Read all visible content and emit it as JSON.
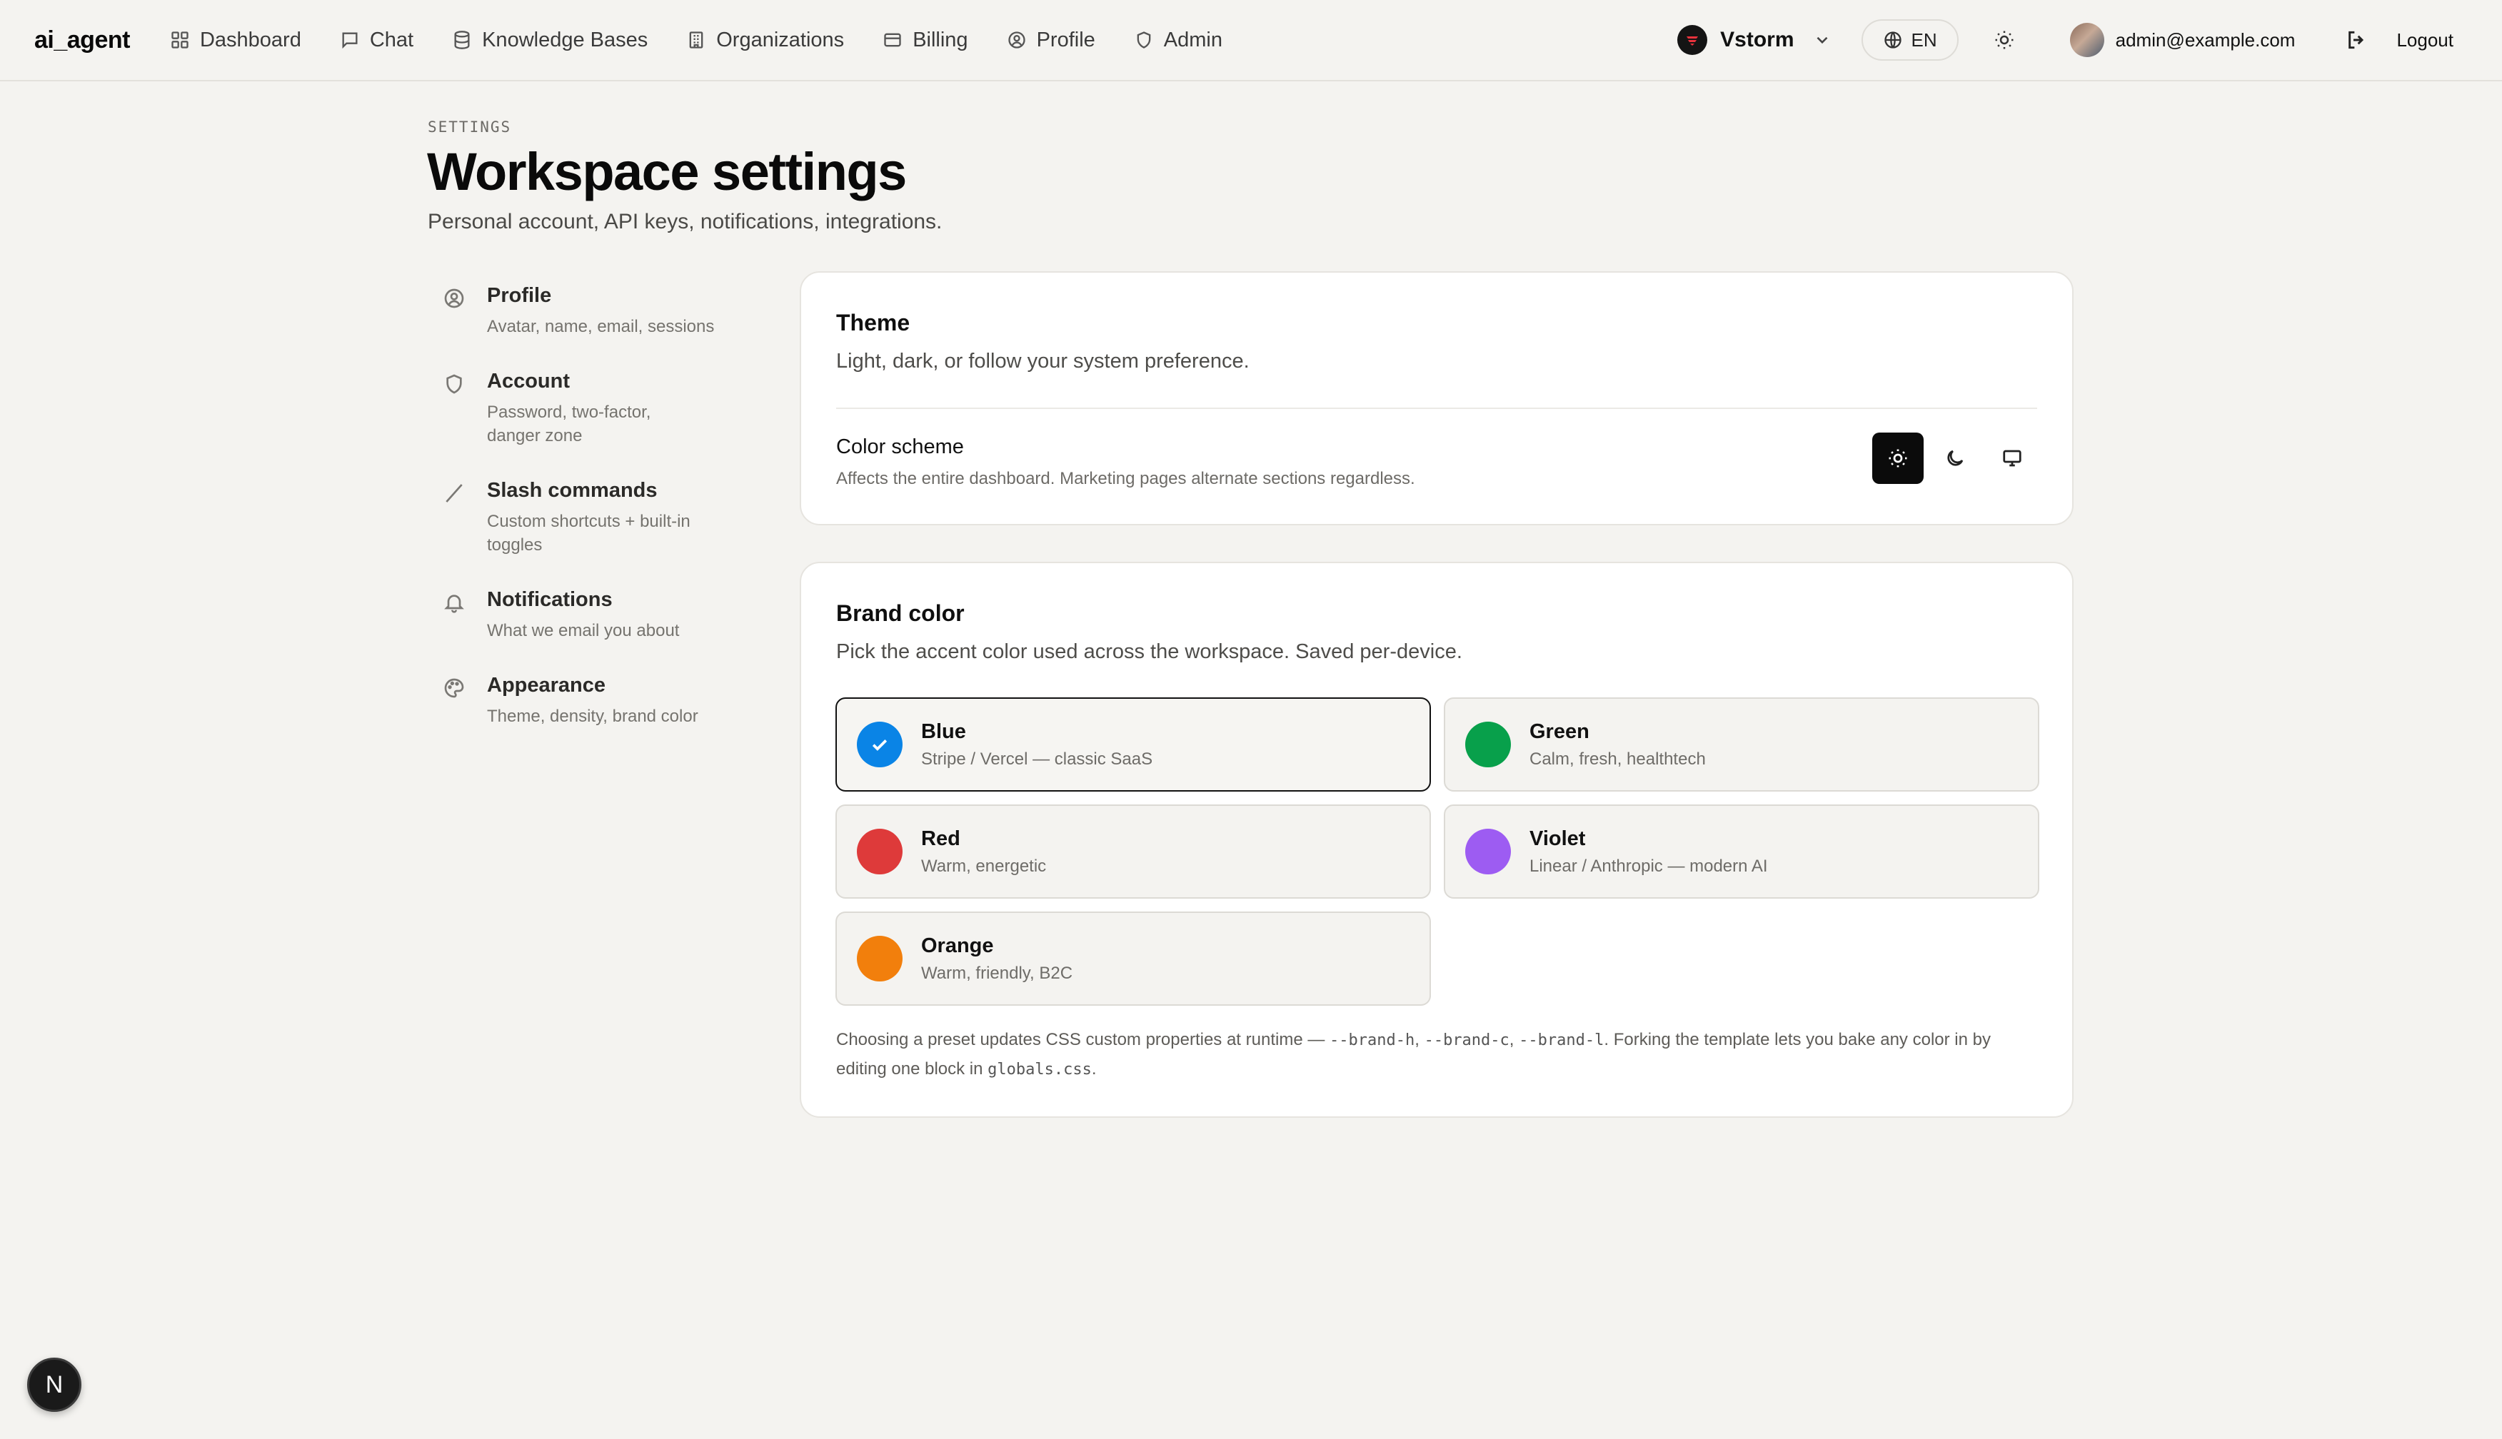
{
  "app": {
    "brand": "ai_agent"
  },
  "nav": {
    "items": [
      {
        "label": "Dashboard",
        "icon": "grid-icon"
      },
      {
        "label": "Chat",
        "icon": "chat-icon"
      },
      {
        "label": "Knowledge Bases",
        "icon": "database-icon"
      },
      {
        "label": "Organizations",
        "icon": "building-icon"
      },
      {
        "label": "Billing",
        "icon": "card-icon"
      },
      {
        "label": "Profile",
        "icon": "user-circle-icon"
      },
      {
        "label": "Admin",
        "icon": "shield-icon"
      }
    ],
    "org": "Vstorm",
    "language": "EN",
    "user_email": "admin@example.com",
    "logout": "Logout"
  },
  "header": {
    "eyebrow": "SETTINGS",
    "title": "Workspace settings",
    "subtitle": "Personal account, API keys, notifications, integrations."
  },
  "sidebar": {
    "items": [
      {
        "title": "Profile",
        "desc": "Avatar, name, email, sessions",
        "icon": "user-circle-icon"
      },
      {
        "title": "Account",
        "desc": "Password, two-factor, danger zone",
        "icon": "shield-icon"
      },
      {
        "title": "Slash commands",
        "desc": "Custom shortcuts + built-in toggles",
        "icon": "slash-icon"
      },
      {
        "title": "Notifications",
        "desc": "What we email you about",
        "icon": "bell-icon"
      },
      {
        "title": "Appearance",
        "desc": "Theme, density, brand color",
        "icon": "palette-icon"
      }
    ]
  },
  "theme": {
    "title": "Theme",
    "desc": "Light, dark, or follow your system preference.",
    "scheme_label": "Color scheme",
    "scheme_desc": "Affects the entire dashboard. Marketing pages alternate sections regardless.",
    "selected": "light"
  },
  "brand": {
    "title": "Brand color",
    "desc": "Pick the accent color used across the workspace. Saved per-device.",
    "presets": [
      {
        "name": "Blue",
        "desc": "Stripe / Vercel — classic SaaS",
        "color": "#0a84e6",
        "selected": true
      },
      {
        "name": "Green",
        "desc": "Calm, fresh, healthtech",
        "color": "#08a04b",
        "selected": false
      },
      {
        "name": "Red",
        "desc": "Warm, energetic",
        "color": "#de3a3a",
        "selected": false
      },
      {
        "name": "Violet",
        "desc": "Linear / Anthropic — modern AI",
        "color": "#9d5cf2",
        "selected": false
      },
      {
        "name": "Orange",
        "desc": "Warm, friendly, B2C",
        "color": "#f27f0c",
        "selected": false
      }
    ],
    "footnote": {
      "part1": "Choosing a preset updates CSS custom properties at runtime — ",
      "var_h": "--brand-h",
      "sep1": ", ",
      "var_c": "--brand-c",
      "sep2": ", ",
      "var_l": "--brand-l",
      "part2": ". Forking the template lets you bake any color in by editing one block in ",
      "file": "globals.css",
      "part3": "."
    }
  },
  "badge": {
    "label": "N"
  }
}
